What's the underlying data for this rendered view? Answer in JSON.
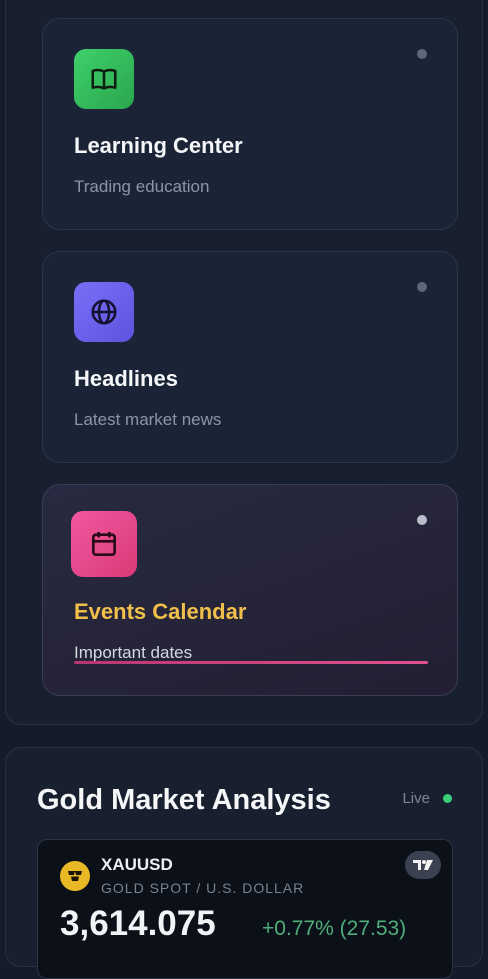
{
  "menu_cards": [
    {
      "title": "Learning Center",
      "subtitle": "Trading education",
      "icon": "book-icon",
      "color": "#37c35f"
    },
    {
      "title": "Headlines",
      "subtitle": "Latest market news",
      "icon": "globe-icon",
      "color": "#6f63ef"
    },
    {
      "title": "Events Calendar",
      "subtitle": "Important dates",
      "icon": "calendar-icon",
      "color": "#e8498a"
    }
  ],
  "gold": {
    "title": "Gold Market Analysis",
    "status": "Live",
    "ticker": {
      "symbol": "XAUUSD",
      "description": "GOLD SPOT / U.S. DOLLAR",
      "price": "3,614.075",
      "change": "+0.77% (27.53)"
    }
  },
  "colors": {
    "accent_title": "#f1c04a",
    "live": "#3ccf7b",
    "positive": "#4fae7a"
  }
}
